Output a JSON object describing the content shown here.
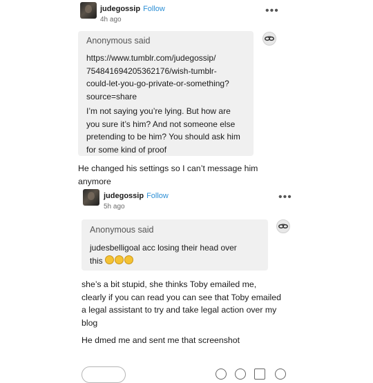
{
  "post1": {
    "username": "judegossip",
    "follow_label": "Follow",
    "time": "4h ago",
    "more_label": "•••",
    "ask": {
      "asker": "Anonymous",
      "said": "said",
      "link": "https://www.tumblr.com/judegossip/754841694205362176/wish-tumblr-could-let-you-go-private-or-something?source=share",
      "link_lines": [
        "https://www.tumblr.com/judegossip/",
        "754841694205362176/wish-tumblr-",
        "could-let-you-go-private-or-something?",
        "source=share"
      ],
      "question": "I'm not saying you're lying. But how are you sure it's him? And not someone else pretending to be him? You should ask him for some kind of proof",
      "question_lines": [
        "I’m not saying you’re lying. But how are",
        "you sure it’s him? And not someone else",
        "pretending to be him? You should ask him",
        "for some kind of proof"
      ]
    },
    "answer_lines": [
      "He changed his settings so I can’t message him",
      "anymore"
    ]
  },
  "post2": {
    "username": "judegossip",
    "follow_label": "Follow",
    "time": "5h ago",
    "more_label": "•••",
    "ask": {
      "asker": "Anonymous",
      "said": "said",
      "question_lines": [
        "judesbelligoal acc losing their head over",
        "this"
      ]
    },
    "answer_lines": [
      "she’s a bit stupid, she thinks Toby emailed me,",
      "clearly if you can read you can see that Toby emailed",
      "a legal assistant to try and take legal action over my",
      "blog"
    ],
    "answer2": "He dmed me and sent me that screenshot"
  }
}
